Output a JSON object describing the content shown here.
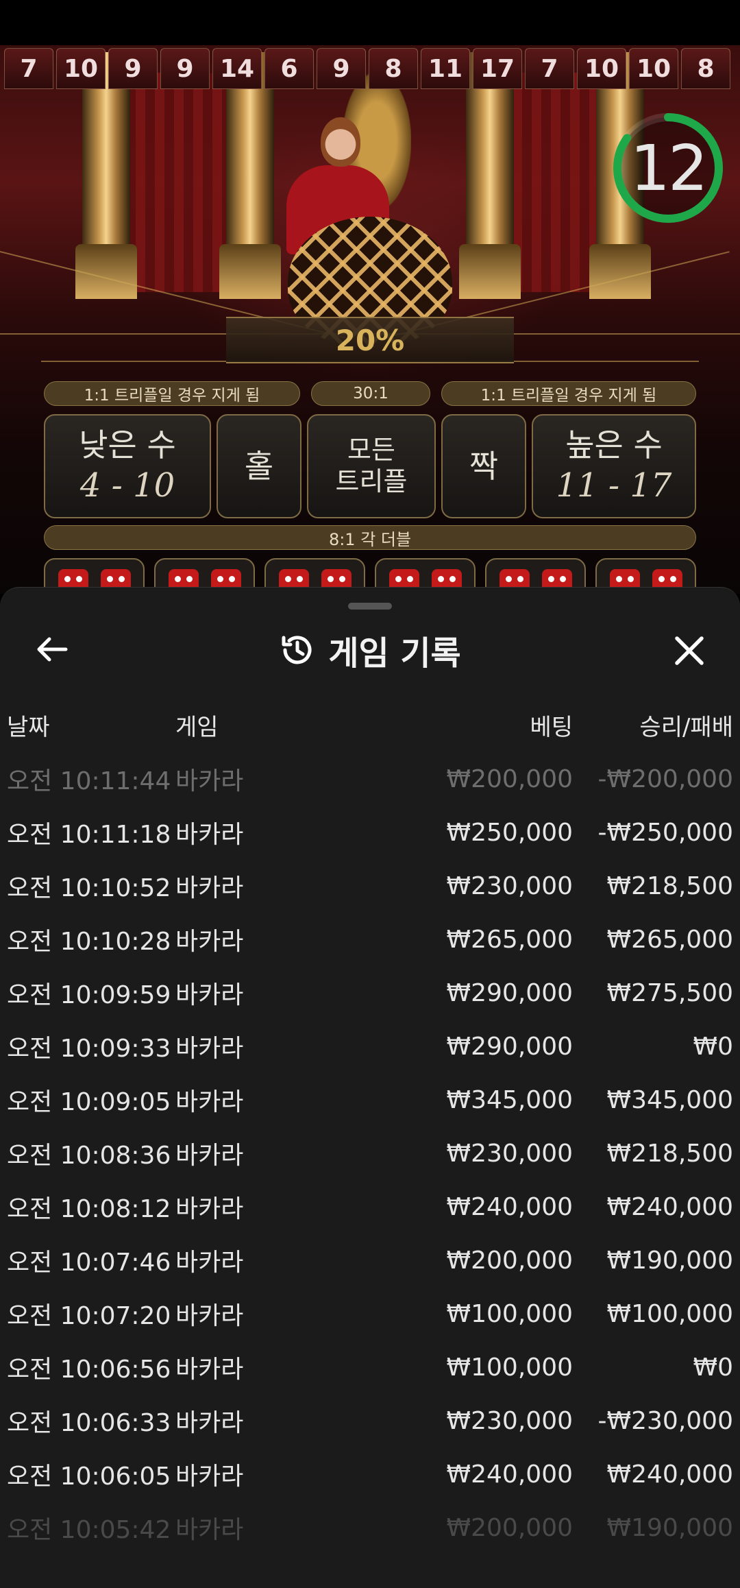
{
  "history_numbers": [
    "7",
    "10",
    "9",
    "9",
    "14",
    "6",
    "9",
    "8",
    "11",
    "17",
    "7",
    "10",
    "10",
    "8"
  ],
  "timer": {
    "value": "12",
    "fraction": 0.85,
    "color": "#1fa84a"
  },
  "payout_percent": "20%",
  "bet_table": {
    "left_note": "1:1 트리플일 경우 지게 됨",
    "center_note": "30:1",
    "right_note": "1:1 트리플일 경우 지게 됨",
    "low": {
      "title": "낮은 수",
      "range": "4 - 10"
    },
    "odd": "홀",
    "all_triples": [
      "모든",
      "트리플"
    ],
    "even": "짝",
    "high": {
      "title": "높은 수",
      "range": "11 - 17"
    },
    "double_note": "8:1 각 더블"
  },
  "panel": {
    "title": "게임 기록",
    "icons": {
      "back": "arrow-left-icon",
      "history": "history-icon",
      "close": "close-icon"
    },
    "columns": {
      "date": "날짜",
      "game": "게임",
      "bet": "베팅",
      "result": "승리/패배"
    },
    "rows": [
      {
        "time": "오전 10:11:44",
        "game": "바카라",
        "bet": "₩200,000",
        "result": "-₩200,000"
      },
      {
        "time": "오전 10:11:18",
        "game": "바카라",
        "bet": "₩250,000",
        "result": "-₩250,000"
      },
      {
        "time": "오전 10:10:52",
        "game": "바카라",
        "bet": "₩230,000",
        "result": "₩218,500"
      },
      {
        "time": "오전 10:10:28",
        "game": "바카라",
        "bet": "₩265,000",
        "result": "₩265,000"
      },
      {
        "time": "오전 10:09:59",
        "game": "바카라",
        "bet": "₩290,000",
        "result": "₩275,500"
      },
      {
        "time": "오전 10:09:33",
        "game": "바카라",
        "bet": "₩290,000",
        "result": "₩0"
      },
      {
        "time": "오전 10:09:05",
        "game": "바카라",
        "bet": "₩345,000",
        "result": "₩345,000"
      },
      {
        "time": "오전 10:08:36",
        "game": "바카라",
        "bet": "₩230,000",
        "result": "₩218,500"
      },
      {
        "time": "오전 10:08:12",
        "game": "바카라",
        "bet": "₩240,000",
        "result": "₩240,000"
      },
      {
        "time": "오전 10:07:46",
        "game": "바카라",
        "bet": "₩200,000",
        "result": "₩190,000"
      },
      {
        "time": "오전 10:07:20",
        "game": "바카라",
        "bet": "₩100,000",
        "result": "₩100,000"
      },
      {
        "time": "오전 10:06:56",
        "game": "바카라",
        "bet": "₩100,000",
        "result": "₩0"
      },
      {
        "time": "오전 10:06:33",
        "game": "바카라",
        "bet": "₩230,000",
        "result": "-₩230,000"
      },
      {
        "time": "오전 10:06:05",
        "game": "바카라",
        "bet": "₩240,000",
        "result": "₩240,000"
      },
      {
        "time": "오전 10:05:42",
        "game": "바카라",
        "bet": "₩200,000",
        "result": "₩190,000"
      }
    ]
  }
}
